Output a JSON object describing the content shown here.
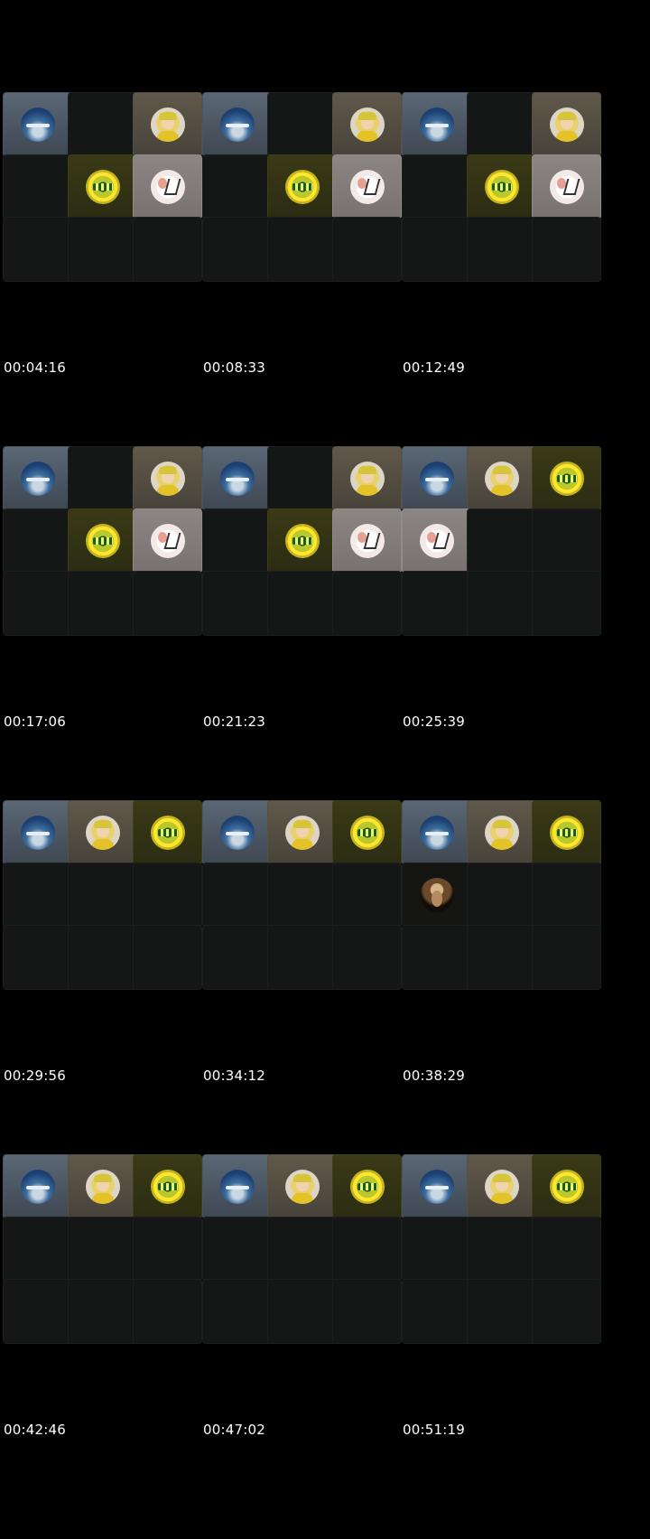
{
  "frames": [
    {
      "timestamp": "00:04:16",
      "tiles": [
        "sea",
        "empty",
        "man",
        "empty",
        "badge",
        "cart",
        "empty",
        "empty",
        "empty"
      ]
    },
    {
      "timestamp": "00:08:33",
      "tiles": [
        "sea",
        "empty",
        "man",
        "empty",
        "badge",
        "cart",
        "empty",
        "empty",
        "empty"
      ]
    },
    {
      "timestamp": "00:12:49",
      "tiles": [
        "sea",
        "empty",
        "man",
        "empty",
        "badge",
        "cart",
        "empty",
        "empty",
        "empty"
      ]
    },
    {
      "timestamp": "00:17:06",
      "tiles": [
        "sea",
        "empty",
        "man",
        "empty",
        "badge",
        "cart",
        "empty",
        "empty",
        "empty"
      ]
    },
    {
      "timestamp": "00:21:23",
      "tiles": [
        "sea",
        "empty",
        "man",
        "empty",
        "badge",
        "cart",
        "empty",
        "empty",
        "empty"
      ]
    },
    {
      "timestamp": "00:25:39",
      "tiles": [
        "sea",
        "man",
        "badge",
        "cart",
        "empty",
        "empty",
        "empty",
        "empty",
        "empty"
      ]
    },
    {
      "timestamp": "00:29:56",
      "tiles": [
        "sea",
        "man",
        "badge",
        "empty",
        "empty",
        "empty",
        "empty",
        "empty",
        "empty"
      ]
    },
    {
      "timestamp": "00:34:12",
      "tiles": [
        "sea",
        "man",
        "badge",
        "empty",
        "empty",
        "empty",
        "empty",
        "empty",
        "empty"
      ]
    },
    {
      "timestamp": "00:38:29",
      "tiles": [
        "sea",
        "man",
        "badge",
        "portrait",
        "empty",
        "empty",
        "empty",
        "empty",
        "empty"
      ]
    },
    {
      "timestamp": "00:42:46",
      "tiles": [
        "sea",
        "man",
        "badge",
        "empty",
        "empty",
        "empty",
        "empty",
        "empty",
        "empty"
      ]
    },
    {
      "timestamp": "00:47:02",
      "tiles": [
        "sea",
        "man",
        "badge",
        "empty",
        "empty",
        "empty",
        "empty",
        "empty",
        "empty"
      ]
    },
    {
      "timestamp": "00:51:19",
      "tiles": [
        "sea",
        "man",
        "badge",
        "empty",
        "empty",
        "empty",
        "empty",
        "empty",
        "empty"
      ]
    }
  ],
  "icons": {
    "sea": "sea-avatar-icon",
    "man": "man-avatar-icon",
    "badge": "badge-avatar-icon",
    "cart": "cart-avatar-icon",
    "portrait": "portrait-avatar-icon"
  },
  "colors": {
    "background": "#000000",
    "empty_tile": "#151716",
    "timestamp_text": "#ffffff"
  }
}
